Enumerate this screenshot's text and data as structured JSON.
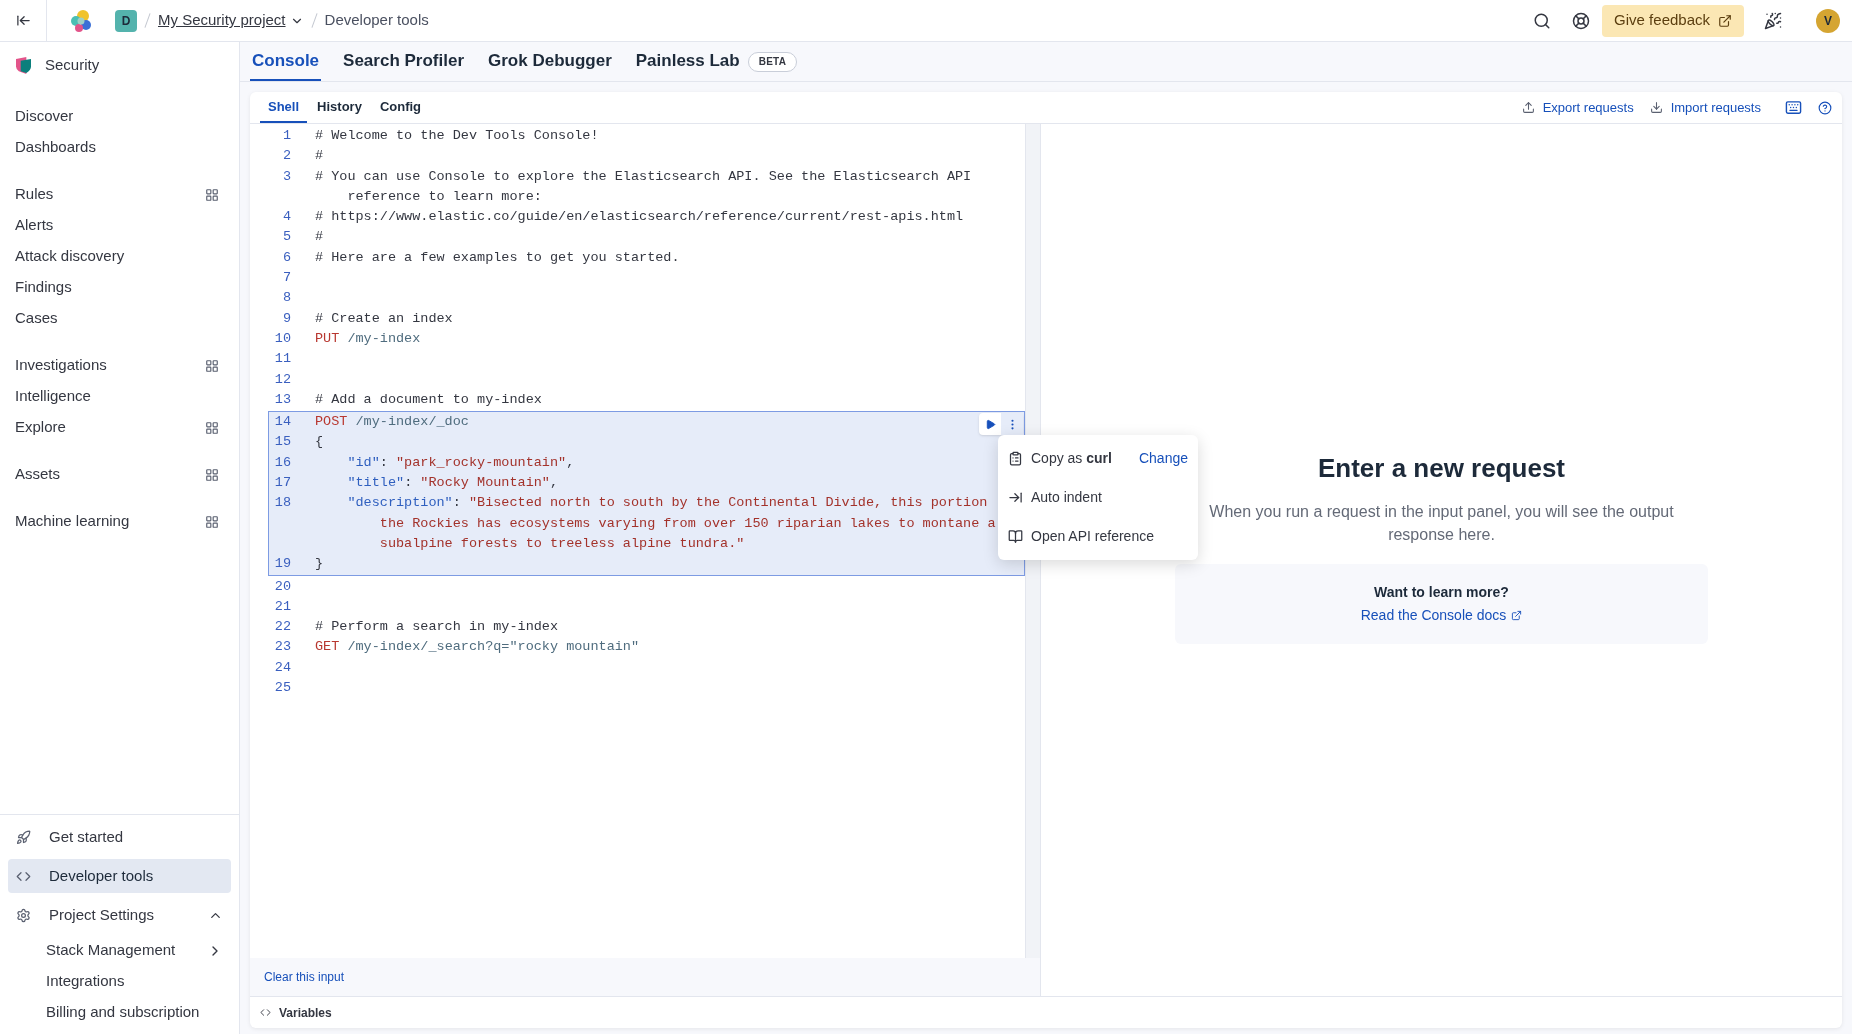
{
  "top_bar": {
    "project_initial": "D",
    "breadcrumbs": [
      {
        "label": "My Security project",
        "kind": "dropdown"
      },
      {
        "label": "Developer tools",
        "kind": "current"
      }
    ],
    "feedback_button": "Give feedback",
    "avatar": "V"
  },
  "sidebar": {
    "title": "Security",
    "groups": [
      [
        {
          "label": "Discover",
          "selected": false,
          "has_panel": false
        },
        {
          "label": "Dashboards",
          "selected": false,
          "has_panel": false
        }
      ],
      [
        {
          "label": "Rules",
          "selected": false,
          "has_panel": true
        },
        {
          "label": "Alerts",
          "selected": false,
          "has_panel": false
        },
        {
          "label": "Attack discovery",
          "selected": false,
          "has_panel": false
        },
        {
          "label": "Findings",
          "selected": false,
          "has_panel": false
        },
        {
          "label": "Cases",
          "selected": false,
          "has_panel": false
        }
      ],
      [
        {
          "label": "Investigations",
          "selected": false,
          "has_panel": true
        },
        {
          "label": "Intelligence",
          "selected": false,
          "has_panel": false
        },
        {
          "label": "Explore",
          "selected": false,
          "has_panel": true
        }
      ],
      [
        {
          "label": "Assets",
          "selected": false,
          "has_panel": true
        }
      ],
      [
        {
          "label": "Machine learning",
          "selected": false,
          "has_panel": true
        }
      ]
    ],
    "footer": [
      {
        "label": "Get started",
        "selected": false
      },
      {
        "label": "Developer tools",
        "selected": true
      },
      {
        "label": "Project Settings",
        "selected": false,
        "expanded": true,
        "children": [
          {
            "label": "Stack Management",
            "selected": false,
            "has_submenu": true
          },
          {
            "label": "Integrations",
            "selected": false,
            "has_submenu": false
          },
          {
            "label": "Billing and subscription",
            "selected": false,
            "has_submenu": false
          }
        ]
      }
    ]
  },
  "tabs": [
    {
      "label": "Console",
      "selected": true
    },
    {
      "label": "Search Profiler",
      "selected": false
    },
    {
      "label": "Grok Debugger",
      "selected": false
    },
    {
      "label": "Painless Lab",
      "selected": false,
      "badge": "BETA"
    }
  ],
  "console": {
    "tabs": [
      {
        "label": "Shell",
        "selected": true
      },
      {
        "label": "History",
        "selected": false
      },
      {
        "label": "Config",
        "selected": false
      }
    ],
    "actions": [
      "Export requests",
      "Import requests"
    ],
    "lines": [
      {
        "number": "1",
        "selected": false,
        "rows": [
          [
            {
              "kind": "comment",
              "text": "# Welcome to the Dev Tools Console!"
            }
          ]
        ]
      },
      {
        "number": "2",
        "selected": false,
        "rows": [
          [
            {
              "kind": "comment",
              "text": "#"
            }
          ]
        ]
      },
      {
        "number": "3",
        "selected": false,
        "rows": [
          [
            {
              "kind": "comment",
              "text": "# You can use Console to explore the Elasticsearch API. See the Elasticsearch API"
            }
          ],
          [
            {
              "kind": "comment",
              "text": "    reference to learn more:"
            }
          ]
        ]
      },
      {
        "number": "4",
        "selected": false,
        "rows": [
          [
            {
              "kind": "comment",
              "text": "# https://www.elastic.co/guide/en/elasticsearch/reference/current/rest-apis.html"
            }
          ]
        ]
      },
      {
        "number": "5",
        "selected": false,
        "rows": [
          [
            {
              "kind": "comment",
              "text": "#"
            }
          ]
        ]
      },
      {
        "number": "6",
        "selected": false,
        "rows": [
          [
            {
              "kind": "comment",
              "text": "# Here are a few examples to get you started."
            }
          ]
        ]
      },
      {
        "number": "7",
        "selected": false,
        "rows": [
          []
        ]
      },
      {
        "number": "8",
        "selected": false,
        "rows": [
          []
        ]
      },
      {
        "number": "9",
        "selected": false,
        "rows": [
          [
            {
              "kind": "comment",
              "text": "# Create an index"
            }
          ]
        ]
      },
      {
        "number": "10",
        "selected": false,
        "rows": [
          [
            {
              "kind": "method",
              "text": "PUT"
            },
            {
              "kind": "path",
              "text": " /my-index"
            }
          ]
        ]
      },
      {
        "number": "11",
        "selected": false,
        "rows": [
          []
        ]
      },
      {
        "number": "12",
        "selected": false,
        "rows": [
          []
        ]
      },
      {
        "number": "13",
        "selected": false,
        "rows": [
          [
            {
              "kind": "comment",
              "text": "# Add a document to my-index"
            }
          ]
        ]
      },
      {
        "number": "14",
        "selected": true,
        "rows": [
          [
            {
              "kind": "method",
              "text": "POST"
            },
            {
              "kind": "path",
              "text": " /my-index/_doc"
            }
          ]
        ]
      },
      {
        "number": "15",
        "selected": true,
        "rows": [
          [
            {
              "kind": "punct",
              "text": "{"
            }
          ]
        ]
      },
      {
        "number": "16",
        "selected": true,
        "rows": [
          [
            {
              "kind": "key",
              "text": "    \"id\""
            },
            {
              "kind": "punct",
              "text": ": "
            },
            {
              "kind": "string",
              "text": "\"park_rocky-mountain\""
            },
            {
              "kind": "punct",
              "text": ","
            }
          ]
        ]
      },
      {
        "number": "17",
        "selected": true,
        "rows": [
          [
            {
              "kind": "key",
              "text": "    \"title\""
            },
            {
              "kind": "punct",
              "text": ": "
            },
            {
              "kind": "string",
              "text": "\"Rocky Mountain\""
            },
            {
              "kind": "punct",
              "text": ","
            }
          ]
        ]
      },
      {
        "number": "18",
        "selected": true,
        "rows": [
          [
            {
              "kind": "key",
              "text": "    \"description\""
            },
            {
              "kind": "punct",
              "text": ": "
            },
            {
              "kind": "string",
              "text": "\"Bisected north to south by the Continental Divide, this portion"
            }
          ],
          [
            {
              "kind": "string",
              "text": "        the Rockies has ecosystems varying from over 150 riparian lakes to montane a"
            }
          ],
          [
            {
              "kind": "string",
              "text": "        subalpine forests to treeless alpine tundra.\""
            }
          ]
        ]
      },
      {
        "number": "19",
        "selected": true,
        "rows": [
          [
            {
              "kind": "punct",
              "text": "}"
            }
          ]
        ]
      },
      {
        "number": "20",
        "selected": false,
        "rows": [
          []
        ]
      },
      {
        "number": "21",
        "selected": false,
        "rows": [
          []
        ]
      },
      {
        "number": "22",
        "selected": false,
        "rows": [
          [
            {
              "kind": "comment",
              "text": "# Perform a search in my-index"
            }
          ]
        ]
      },
      {
        "number": "23",
        "selected": false,
        "rows": [
          [
            {
              "kind": "method",
              "text": "GET"
            },
            {
              "kind": "path",
              "text": " /my-index/_search?q=\"rocky mountain\""
            }
          ]
        ]
      },
      {
        "number": "24",
        "selected": false,
        "rows": [
          []
        ]
      },
      {
        "number": "25",
        "selected": false,
        "rows": [
          []
        ]
      }
    ],
    "menu": [
      {
        "label": "Copy as **curl**",
        "action": "Change"
      },
      {
        "label": "Auto indent"
      },
      {
        "label": "Open API reference"
      }
    ],
    "clear_link": "Clear this input",
    "variables": "Variables"
  },
  "output": {
    "title": "Enter a new request",
    "text": "When you run a request in the input panel, you will see the output response here.",
    "learn_more": {
      "title": "Want to learn more?",
      "link": "Read the Console docs"
    }
  }
}
